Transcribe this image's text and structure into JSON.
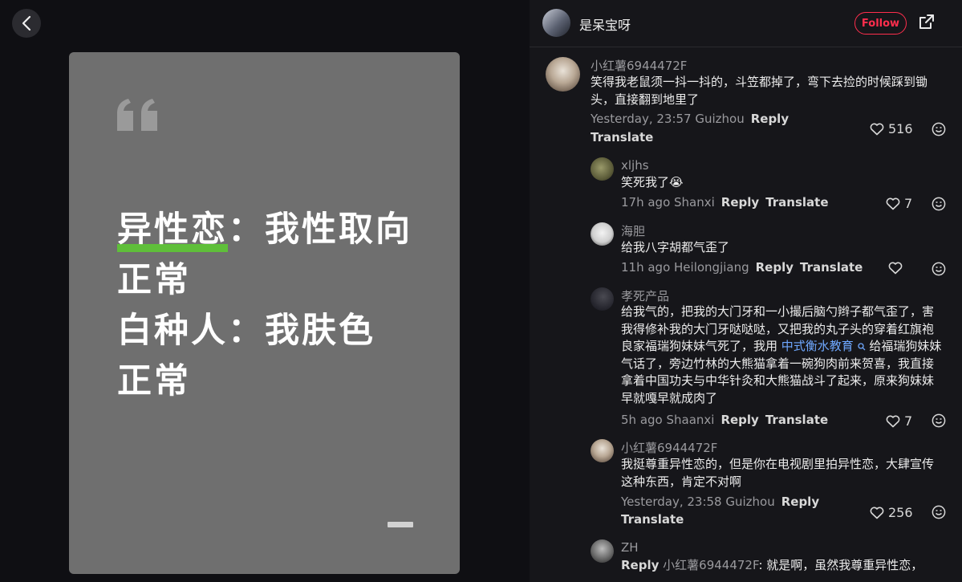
{
  "media": {
    "card_line1_highlight": "异性恋",
    "card_line1_rest": "：我性取向",
    "card_line2": "正常",
    "card_line3": "白种人：我肤色",
    "card_line4": "正常"
  },
  "header": {
    "author_name": "是呆宝呀",
    "follow_label": "Follow"
  },
  "comments": [
    {
      "user": "小红薯6944472F",
      "text": "笑得我老鼠须一抖一抖的，斗笠都掉了，弯下去捡的时候踩到锄头，直接翻到地里了",
      "meta": "Yesterday, 23:57 Guizhou",
      "reply_label": "Reply",
      "translate_label": "Translate",
      "likes": "516"
    },
    {
      "user": "xljhs",
      "text": "笑死我了😭",
      "meta": "17h ago Shanxi",
      "reply_label": "Reply",
      "translate_label": "Translate",
      "likes": "7"
    },
    {
      "user": "海胆",
      "text": "给我八字胡都气歪了",
      "meta": "11h ago Heilongjiang",
      "reply_label": "Reply",
      "translate_label": "Translate",
      "likes": ""
    },
    {
      "user": "孝死产品",
      "text_before_link": "给我气的，把我的大门牙和一小撮后脑勺辫子都气歪了，害我得修补我的大门牙哒哒哒，又把我的丸子头的穿着红旗袍良家福瑞狗妹妹气死了，我用 ",
      "link_text": "中式衡水教育",
      "text_after_link": " 给福瑞狗妹妹气话了，旁边竹林的大熊猫拿着一碗狗肉前来贺喜，我直接拿着中国功夫与中华针灸和大熊猫战斗了起来，原来狗妹妹早就嘎早就成肉了",
      "meta": "5h ago Shaanxi",
      "reply_label": "Reply",
      "translate_label": "Translate",
      "likes": "7"
    },
    {
      "user": "小红薯6944472F",
      "text": "我挺尊重异性恋的，但是你在电视剧里拍异性恋，大肆宣传这种东西，肯定不对啊",
      "meta": "Yesterday, 23:58 Guizhou",
      "reply_label": "Reply",
      "translate_label": "Translate",
      "likes": "256"
    },
    {
      "user": "ZH",
      "reply_label": "Reply",
      "reply_to": "小红薯6944472F",
      "text": ": 就是啊，虽然我尊重异性恋，"
    }
  ],
  "colors": {
    "accent": "#ff2e4d",
    "highlight": "#5fbf3a",
    "link": "#6fa8ff",
    "card": "#6f6f6f",
    "panel": "#16161a"
  },
  "icons": [
    "chevron-left-icon",
    "quote-icon",
    "share-icon",
    "heart-icon",
    "smile-icon",
    "search-icon"
  ]
}
